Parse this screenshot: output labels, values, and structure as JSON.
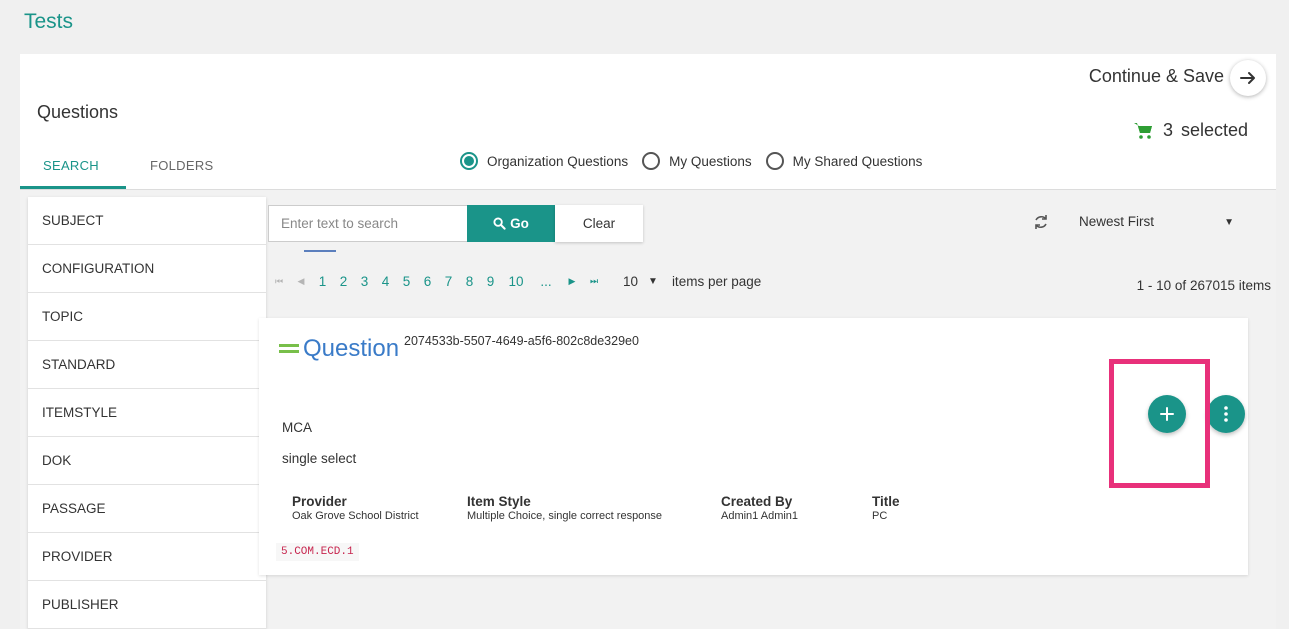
{
  "page": {
    "title": "Tests"
  },
  "header": {
    "section_title": "Questions",
    "tabs": [
      "SEARCH",
      "FOLDERS"
    ],
    "continue_label": "Continue & Save",
    "selected_count": "3",
    "selected_label": "selected"
  },
  "sidebar": {
    "items": [
      "SUBJECT",
      "CONFIGURATION",
      "TOPIC",
      "STANDARD",
      "ITEMSTYLE",
      "DOK",
      "PASSAGE",
      "PROVIDER",
      "PUBLISHER"
    ]
  },
  "filters": {
    "radios": [
      "Organization Questions",
      "My Questions",
      "My Shared Questions"
    ],
    "selected_radio": "Organization Questions"
  },
  "search": {
    "placeholder": "Enter text to search",
    "go_label": "Go",
    "clear_label": "Clear"
  },
  "sort": {
    "value": "Newest First"
  },
  "pagination": {
    "pages": [
      "1",
      "2",
      "3",
      "4",
      "5",
      "6",
      "7",
      "8",
      "9",
      "10"
    ],
    "current": "1",
    "ellipsis": "...",
    "per_page": "10",
    "per_page_label": "items per page",
    "summary": "1 - 10 of 267015 items"
  },
  "question": {
    "title": "Question",
    "id": "2074533b-5507-4649-a5f6-802c8de329e0",
    "type": "MCA",
    "subtype": "single select",
    "meta": [
      {
        "label": "Provider",
        "value": "Oak Grove School District"
      },
      {
        "label": "Item Style",
        "value": "Multiple Choice, single correct response"
      },
      {
        "label": "Created By",
        "value": "Admin1 Admin1"
      },
      {
        "label": "Title",
        "value": "PC"
      }
    ],
    "standard_tag": "5.COM.ECD.1"
  },
  "colors": {
    "accent": "#1a9489",
    "question_title": "#3a7bc8",
    "equals_icon": "#78bf4a",
    "highlight": "#e8307a",
    "tag_text": "#c7254e"
  },
  "icons": [
    "arrow-right-icon",
    "cart-icon",
    "search-icon",
    "refresh-icon",
    "plus-icon",
    "more-vertical-icon",
    "equals-icon"
  ]
}
